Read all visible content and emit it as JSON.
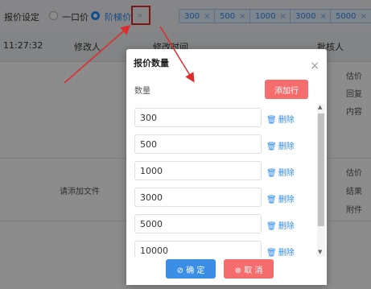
{
  "toolbar": {
    "label": "报价设定",
    "option_fixed": "一口价",
    "option_tiered": "阶梯价",
    "next_arrow": "»",
    "tags": [
      "300",
      "500",
      "1000",
      "3000",
      "5000"
    ],
    "tag_close": "×"
  },
  "table_header": {
    "time": "11:27:32",
    "modifier": "修改人",
    "modified_time": "修改时间",
    "approver": "批核人"
  },
  "background_rows": {
    "right_col_1": [
      "估价",
      "回复",
      "内容"
    ],
    "add_file": "请添加文件",
    "right_col_2": [
      "估价",
      "结果",
      "附件"
    ]
  },
  "modal": {
    "title": "报价数量",
    "close": "×",
    "qty_label": "数量",
    "add_row": "添加行",
    "quantities": [
      "300",
      "500",
      "1000",
      "3000",
      "5000",
      "10000"
    ],
    "delete_label": "删除",
    "delete_icon": "trash-icon",
    "confirm": "确 定",
    "cancel": "取 消"
  },
  "colors": {
    "primary": "#2d8cf0",
    "danger": "#f56c6c",
    "annotation": "#e02b2b"
  }
}
